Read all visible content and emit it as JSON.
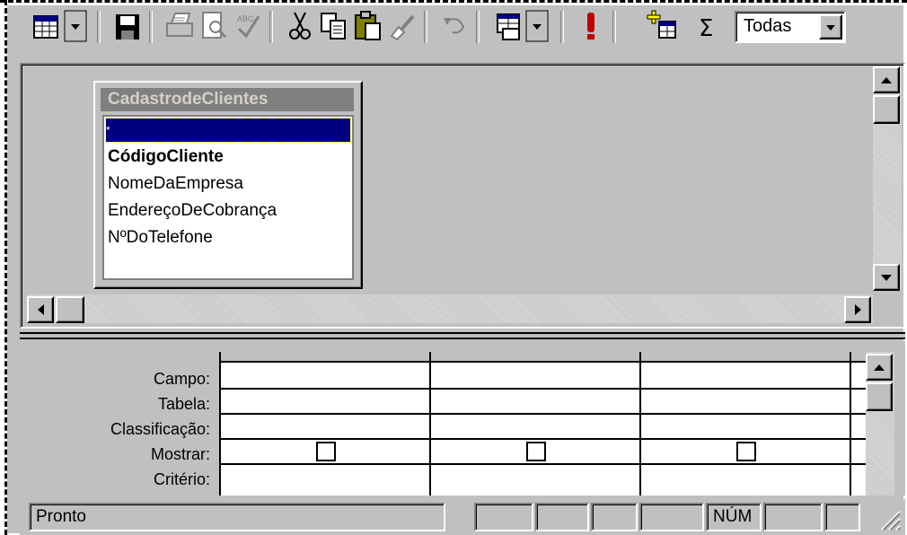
{
  "toolbar": {
    "items": [
      {
        "name": "view-button",
        "icon": "datasheet-view-icon"
      },
      {
        "name": "save-button",
        "icon": "floppy-disk-icon"
      },
      {
        "name": "print-button",
        "icon": "printer-icon"
      },
      {
        "name": "print-preview-button",
        "icon": "print-preview-icon"
      },
      {
        "name": "spelling-button",
        "icon": "spelling-check-icon"
      },
      {
        "name": "cut-button",
        "icon": "scissors-icon"
      },
      {
        "name": "copy-button",
        "icon": "copy-icon"
      },
      {
        "name": "paste-button",
        "icon": "clipboard-icon"
      },
      {
        "name": "format-painter-button",
        "icon": "brush-icon"
      },
      {
        "name": "undo-button",
        "icon": "undo-icon"
      },
      {
        "name": "query-type-button",
        "icon": "query-type-icon"
      },
      {
        "name": "run-button",
        "icon": "exclamation-icon"
      },
      {
        "name": "show-table-button",
        "icon": "show-table-icon"
      },
      {
        "name": "totals-button",
        "icon": "sigma-icon"
      }
    ],
    "top_values": "Todas"
  },
  "table": {
    "title": "CadastrodeClientes",
    "fields": [
      "*",
      "CódigoCliente",
      "NomeDaEmpresa",
      "EndereçoDeCobrança",
      "NºDoTelefone"
    ]
  },
  "grid": {
    "row_labels": [
      "Campo:",
      "Tabela:",
      "Classificação:",
      "Mostrar:",
      "Critério:"
    ],
    "columns": 3
  },
  "status": {
    "message": "Pronto",
    "indicators": [
      "",
      "",
      "",
      "",
      "NÚM",
      "",
      ""
    ]
  }
}
